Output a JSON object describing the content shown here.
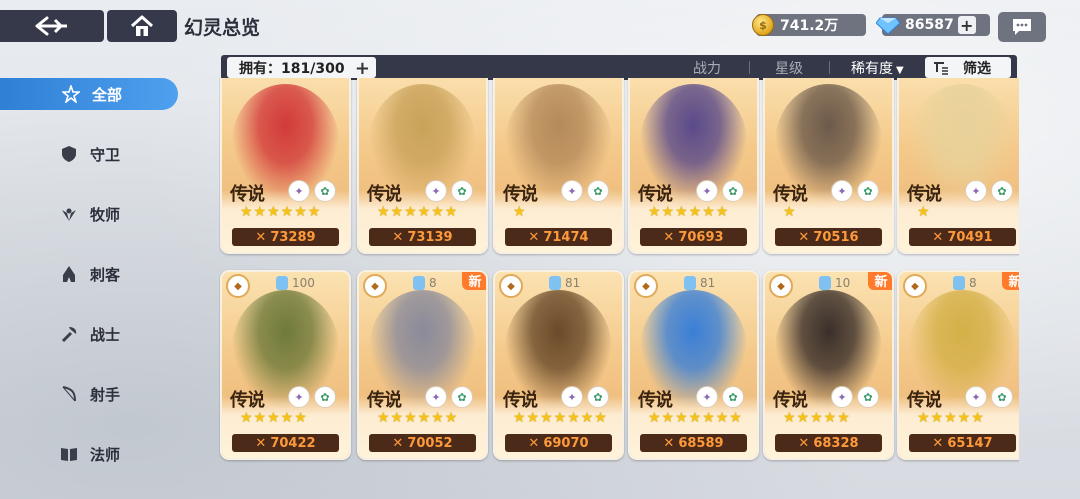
{
  "header": {
    "title": "幻灵总览",
    "gold": "741.2万",
    "gems": "86587"
  },
  "filterbar": {
    "owned_label": "拥有：181/300",
    "sort_power": "战力",
    "sort_star": "星级",
    "sort_rarity": "稀有度",
    "filter_label": "筛选"
  },
  "sidebar": {
    "items": [
      {
        "label": "全部",
        "icon": "star-outline-icon"
      },
      {
        "label": "守卫",
        "icon": "shield-icon"
      },
      {
        "label": "牧师",
        "icon": "wings-icon"
      },
      {
        "label": "刺客",
        "icon": "hood-icon"
      },
      {
        "label": "战士",
        "icon": "axe-icon"
      },
      {
        "label": "射手",
        "icon": "bow-icon"
      },
      {
        "label": "法师",
        "icon": "book-icon"
      }
    ]
  },
  "cards": [
    {
      "rarity": "传说",
      "power": "73289",
      "stars": "★★★★★★",
      "level": "",
      "is_new": false,
      "art": "#d23a3a"
    },
    {
      "rarity": "传说",
      "power": "73139",
      "stars": "★★★★★★",
      "level": "",
      "is_new": false,
      "art": "#c9a25a"
    },
    {
      "rarity": "传说",
      "power": "71474",
      "stars": "★",
      "level": "",
      "is_new": false,
      "art": "#b58a5a"
    },
    {
      "rarity": "传说",
      "power": "70693",
      "stars": "★★★★★★",
      "level": "",
      "is_new": false,
      "art": "#5a4a8a"
    },
    {
      "rarity": "传说",
      "power": "70516",
      "stars": "★",
      "level": "",
      "is_new": false,
      "art": "#6d5a4a"
    },
    {
      "rarity": "传说",
      "power": "70491",
      "stars": "★",
      "level": "",
      "is_new": false,
      "art": "#e8d29a"
    },
    {
      "rarity": "传说",
      "power": "70422",
      "stars": "★★★★★",
      "level": "100",
      "is_new": false,
      "art": "#6f7a3a"
    },
    {
      "rarity": "传说",
      "power": "70052",
      "stars": "★★★★★★",
      "level": "8",
      "is_new": true,
      "art": "#8a8a9a"
    },
    {
      "rarity": "传说",
      "power": "69070",
      "stars": "★★★★★★★",
      "level": "81",
      "is_new": false,
      "art": "#6a4a2a"
    },
    {
      "rarity": "传说",
      "power": "68589",
      "stars": "★★★★★★★",
      "level": "81",
      "is_new": false,
      "art": "#3a7fd6"
    },
    {
      "rarity": "传说",
      "power": "68328",
      "stars": "★★★★★",
      "level": "10",
      "is_new": true,
      "art": "#3a2f2a"
    },
    {
      "rarity": "传说",
      "power": "65147",
      "stars": "★★★★★",
      "level": "8",
      "is_new": true,
      "art": "#d4b048"
    }
  ]
}
